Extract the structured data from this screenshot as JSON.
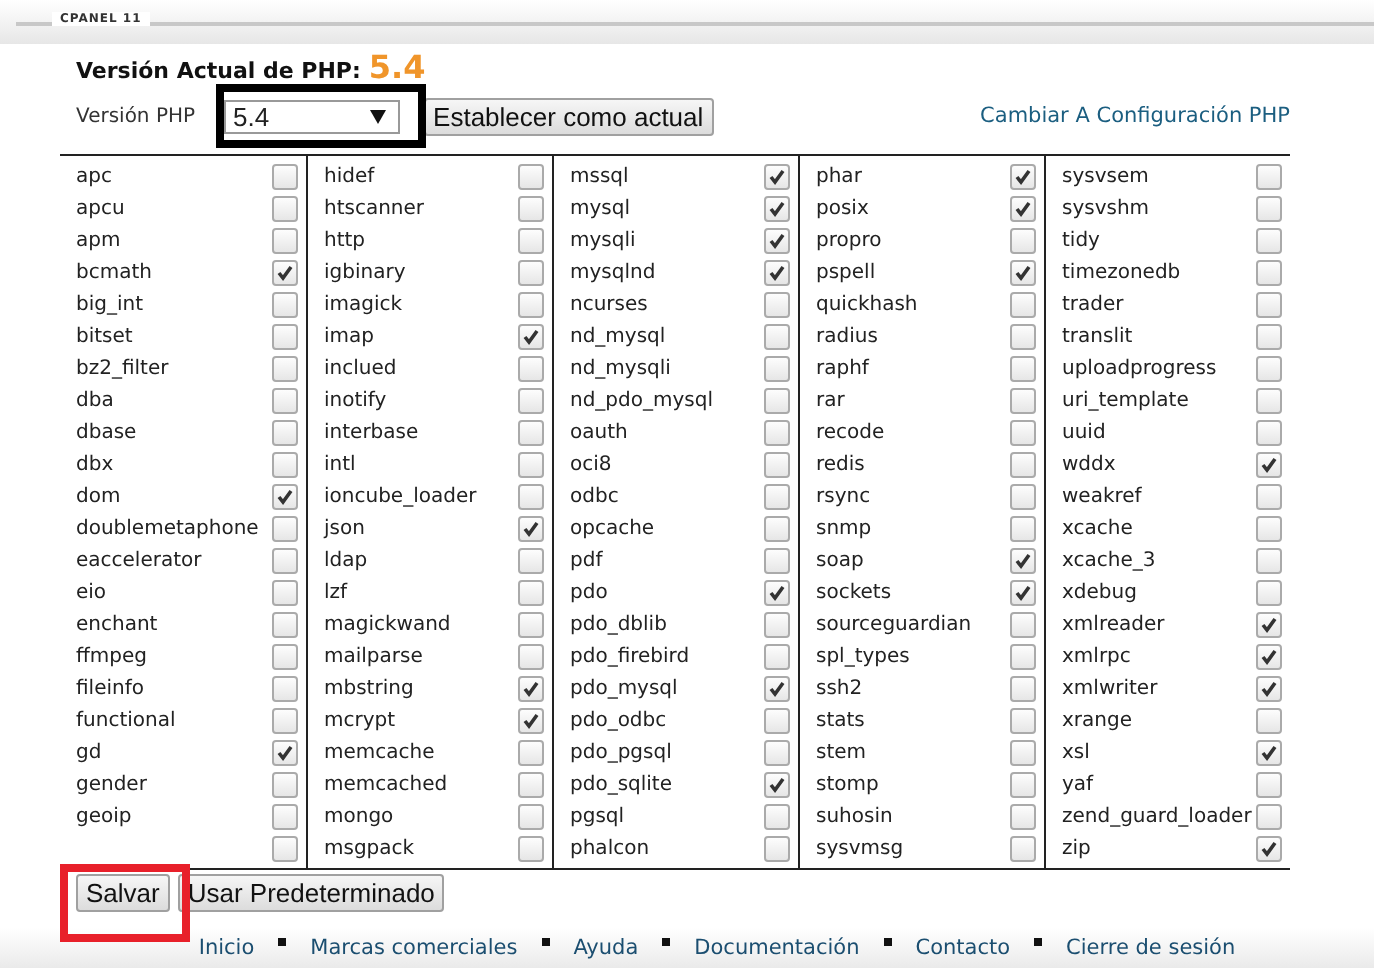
{
  "header": {
    "label": "CPANEL 11"
  },
  "current_version": {
    "label": "Versión Actual de PHP:",
    "value": "5.4"
  },
  "version_row": {
    "label": "Versión PHP",
    "select": {
      "value": "5.4"
    },
    "set_button": "Establecer como actual",
    "config_link": "Cambiar A Configuración PHP"
  },
  "extension_columns": [
    [
      {
        "label": "apc",
        "checked": false
      },
      {
        "label": "apcu",
        "checked": false
      },
      {
        "label": "apm",
        "checked": false
      },
      {
        "label": "bcmath",
        "checked": true
      },
      {
        "label": "big_int",
        "checked": false
      },
      {
        "label": "bitset",
        "checked": false
      },
      {
        "label": "bz2_filter",
        "checked": false
      },
      {
        "label": "dba",
        "checked": false
      },
      {
        "label": "dbase",
        "checked": false
      },
      {
        "label": "dbx",
        "checked": false
      },
      {
        "label": "dom",
        "checked": true
      },
      {
        "label": "doublemetaphone",
        "checked": false
      },
      {
        "label": "eaccelerator",
        "checked": false
      },
      {
        "label": "eio",
        "checked": false
      },
      {
        "label": "enchant",
        "checked": false
      },
      {
        "label": "ffmpeg",
        "checked": false
      },
      {
        "label": "fileinfo",
        "checked": false
      },
      {
        "label": "functional",
        "checked": false
      },
      {
        "label": "gd",
        "checked": true
      },
      {
        "label": "gender",
        "checked": false
      },
      {
        "label": "geoip",
        "checked": false
      },
      {
        "checked": false
      }
    ],
    [
      {
        "label": "hidef",
        "checked": false
      },
      {
        "label": "htscanner",
        "checked": false
      },
      {
        "label": "http",
        "checked": false
      },
      {
        "label": "igbinary",
        "checked": false
      },
      {
        "label": "imagick",
        "checked": false
      },
      {
        "label": "imap",
        "checked": true
      },
      {
        "label": "inclued",
        "checked": false
      },
      {
        "label": "inotify",
        "checked": false
      },
      {
        "label": "interbase",
        "checked": false
      },
      {
        "label": "intl",
        "checked": false
      },
      {
        "label": "ioncube_loader",
        "checked": false
      },
      {
        "label": "json",
        "checked": true
      },
      {
        "label": "ldap",
        "checked": false
      },
      {
        "label": "lzf",
        "checked": false
      },
      {
        "label": "magickwand",
        "checked": false
      },
      {
        "label": "mailparse",
        "checked": false
      },
      {
        "label": "mbstring",
        "checked": true
      },
      {
        "label": "mcrypt",
        "checked": true
      },
      {
        "label": "memcache",
        "checked": false
      },
      {
        "label": "memcached",
        "checked": false
      },
      {
        "label": "mongo",
        "checked": false
      },
      {
        "label": "msgpack",
        "checked": false
      }
    ],
    [
      {
        "label": "mssql",
        "checked": true
      },
      {
        "label": "mysql",
        "checked": true
      },
      {
        "label": "mysqli",
        "checked": true
      },
      {
        "label": "mysqlnd",
        "checked": true
      },
      {
        "label": "ncurses",
        "checked": false
      },
      {
        "label": "nd_mysql",
        "checked": false
      },
      {
        "label": "nd_mysqli",
        "checked": false
      },
      {
        "label": "nd_pdo_mysql",
        "checked": false
      },
      {
        "label": "oauth",
        "checked": false
      },
      {
        "label": "oci8",
        "checked": false
      },
      {
        "label": "odbc",
        "checked": false
      },
      {
        "label": "opcache",
        "checked": false
      },
      {
        "label": "pdf",
        "checked": false
      },
      {
        "label": "pdo",
        "checked": true
      },
      {
        "label": "pdo_dblib",
        "checked": false
      },
      {
        "label": "pdo_firebird",
        "checked": false
      },
      {
        "label": "pdo_mysql",
        "checked": true
      },
      {
        "label": "pdo_odbc",
        "checked": false
      },
      {
        "label": "pdo_pgsql",
        "checked": false
      },
      {
        "label": "pdo_sqlite",
        "checked": true
      },
      {
        "label": "pgsql",
        "checked": false
      },
      {
        "label": "phalcon",
        "checked": false
      }
    ],
    [
      {
        "label": "phar",
        "checked": true
      },
      {
        "label": "posix",
        "checked": true
      },
      {
        "label": "propro",
        "checked": false
      },
      {
        "label": "pspell",
        "checked": true
      },
      {
        "label": "quickhash",
        "checked": false
      },
      {
        "label": "radius",
        "checked": false
      },
      {
        "label": "raphf",
        "checked": false
      },
      {
        "label": "rar",
        "checked": false
      },
      {
        "label": "recode",
        "checked": false
      },
      {
        "label": "redis",
        "checked": false
      },
      {
        "label": "rsync",
        "checked": false
      },
      {
        "label": "snmp",
        "checked": false
      },
      {
        "label": "soap",
        "checked": true
      },
      {
        "label": "sockets",
        "checked": true
      },
      {
        "label": "sourceguardian",
        "checked": false
      },
      {
        "label": "spl_types",
        "checked": false
      },
      {
        "label": "ssh2",
        "checked": false
      },
      {
        "label": "stats",
        "checked": false
      },
      {
        "label": "stem",
        "checked": false
      },
      {
        "label": "stomp",
        "checked": false
      },
      {
        "label": "suhosin",
        "checked": false
      },
      {
        "label": "sysvmsg",
        "checked": false
      }
    ],
    [
      {
        "label": "sysvsem",
        "checked": false
      },
      {
        "label": "sysvshm",
        "checked": false
      },
      {
        "label": "tidy",
        "checked": false
      },
      {
        "label": "timezonedb",
        "checked": false
      },
      {
        "label": "trader",
        "checked": false
      },
      {
        "label": "translit",
        "checked": false
      },
      {
        "label": "uploadprogress",
        "checked": false
      },
      {
        "label": "uri_template",
        "checked": false
      },
      {
        "label": "uuid",
        "checked": false
      },
      {
        "label": "wddx",
        "checked": true
      },
      {
        "label": "weakref",
        "checked": false
      },
      {
        "label": "xcache",
        "checked": false
      },
      {
        "label": "xcache_3",
        "checked": false
      },
      {
        "label": "xdebug",
        "checked": false
      },
      {
        "label": "xmlreader",
        "checked": true
      },
      {
        "label": "xmlrpc",
        "checked": true
      },
      {
        "label": "xmlwriter",
        "checked": true
      },
      {
        "label": "xrange",
        "checked": false
      },
      {
        "label": "xsl",
        "checked": true
      },
      {
        "label": "yaf",
        "checked": false
      },
      {
        "label": "zend_guard_loader",
        "checked": false
      },
      {
        "label": "zip",
        "checked": true
      }
    ]
  ],
  "buttons": [
    "Salvar",
    "Usar Predeterminado"
  ],
  "footer_links": [
    "Inicio",
    "Marcas comerciales",
    "Ayuda",
    "Documentación",
    "Contacto",
    "Cierre de sesión"
  ]
}
